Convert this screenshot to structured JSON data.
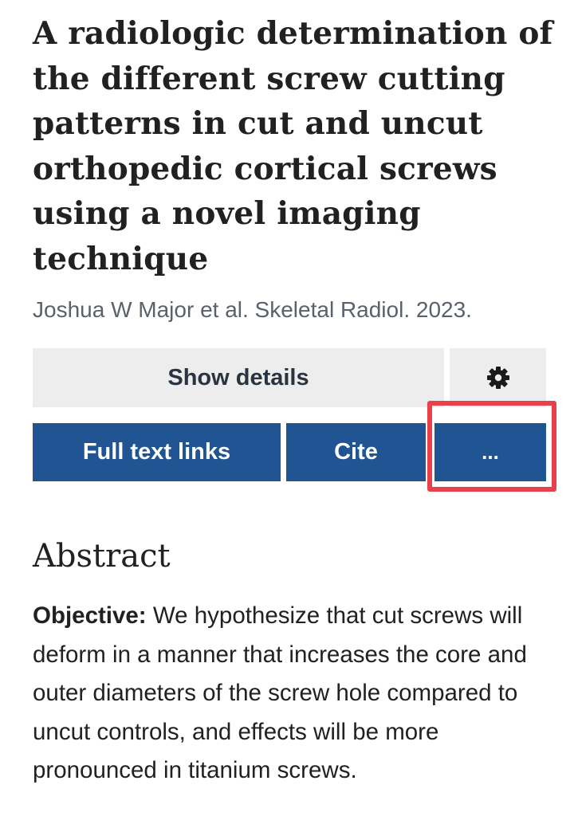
{
  "article": {
    "title": "A radiologic determination of the different screw cutting patterns in cut and uncut orthopedic cortical screws using a novel imaging technique",
    "citation": "Joshua W Major et al. Skeletal Radiol. 2023."
  },
  "actions": {
    "show_details_label": "Show details",
    "settings_icon": "gear-icon",
    "full_text_label": "Full text links",
    "cite_label": "Cite",
    "more_label": "..."
  },
  "abstract": {
    "heading": "Abstract",
    "objective_label": "Objective:",
    "objective_text": " We hypothesize that cut screws will deform in a manner that increases the core and outer diameters of the screw hole compared to uncut controls, and effects will be more pronounced in titanium screws."
  },
  "colors": {
    "primary_button": "#205493",
    "secondary_button": "#ededed",
    "highlight": "#e8414b"
  }
}
